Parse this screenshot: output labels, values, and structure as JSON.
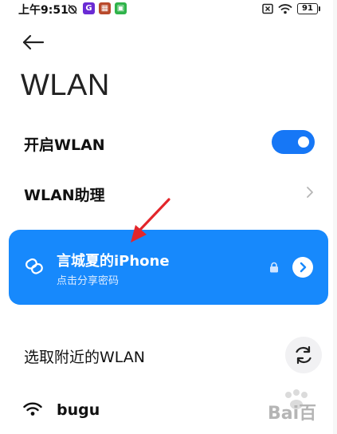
{
  "status_bar": {
    "time": "上午9:51",
    "battery": "91",
    "app_badges": [
      {
        "name": "app-badge-1",
        "color": "#6a2bd4",
        "glyph": "G"
      },
      {
        "name": "app-badge-2",
        "color": "#b94a2c",
        "glyph": "▦"
      },
      {
        "name": "app-badge-3",
        "color": "#2fb34a",
        "glyph": "▣"
      }
    ]
  },
  "page": {
    "title": "WLAN"
  },
  "settings": {
    "wlan_toggle_label": "开启WLAN",
    "wlan_enabled": true,
    "assistant_label": "WLAN助理"
  },
  "hotspot": {
    "name": "言城夏的iPhone",
    "subtitle": "点击分享密码",
    "card_color": "#1789fc"
  },
  "nearby": {
    "section_label": "选取附近的WLAN",
    "networks": [
      {
        "name": "bugu"
      }
    ]
  },
  "watermark": {
    "text": "Bai百"
  },
  "colors": {
    "accent": "#1677f6",
    "annotation_arrow": "#e3262b"
  }
}
